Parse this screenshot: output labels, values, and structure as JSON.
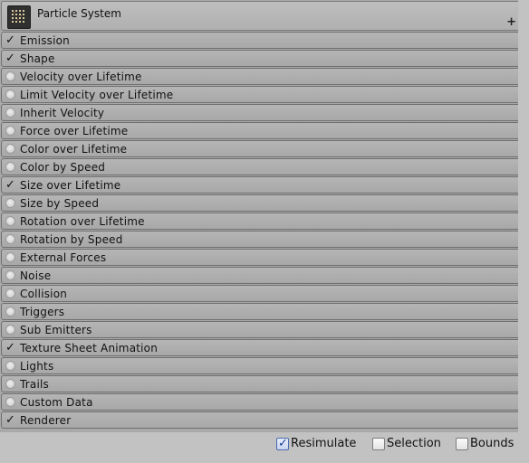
{
  "header": {
    "title": "Particle System",
    "plus": "+"
  },
  "check_glyph": "✓",
  "modules": [
    {
      "label": "Emission",
      "enabled": true
    },
    {
      "label": "Shape",
      "enabled": true
    },
    {
      "label": "Velocity over Lifetime",
      "enabled": false
    },
    {
      "label": "Limit Velocity over Lifetime",
      "enabled": false
    },
    {
      "label": "Inherit Velocity",
      "enabled": false
    },
    {
      "label": "Force over Lifetime",
      "enabled": false
    },
    {
      "label": "Color over Lifetime",
      "enabled": false
    },
    {
      "label": "Color by Speed",
      "enabled": false
    },
    {
      "label": "Size over Lifetime",
      "enabled": true
    },
    {
      "label": "Size by Speed",
      "enabled": false
    },
    {
      "label": "Rotation over Lifetime",
      "enabled": false
    },
    {
      "label": "Rotation by Speed",
      "enabled": false
    },
    {
      "label": "External Forces",
      "enabled": false
    },
    {
      "label": "Noise",
      "enabled": false
    },
    {
      "label": "Collision",
      "enabled": false
    },
    {
      "label": "Triggers",
      "enabled": false
    },
    {
      "label": "Sub Emitters",
      "enabled": false
    },
    {
      "label": "Texture Sheet Animation",
      "enabled": true
    },
    {
      "label": "Lights",
      "enabled": false
    },
    {
      "label": "Trails",
      "enabled": false
    },
    {
      "label": "Custom Data",
      "enabled": false
    },
    {
      "label": "Renderer",
      "enabled": true
    }
  ],
  "options": {
    "resimulate": {
      "label": "Resimulate",
      "checked": true
    },
    "selection": {
      "label": "Selection",
      "checked": false
    },
    "bounds": {
      "label": "Bounds",
      "checked": false
    }
  }
}
